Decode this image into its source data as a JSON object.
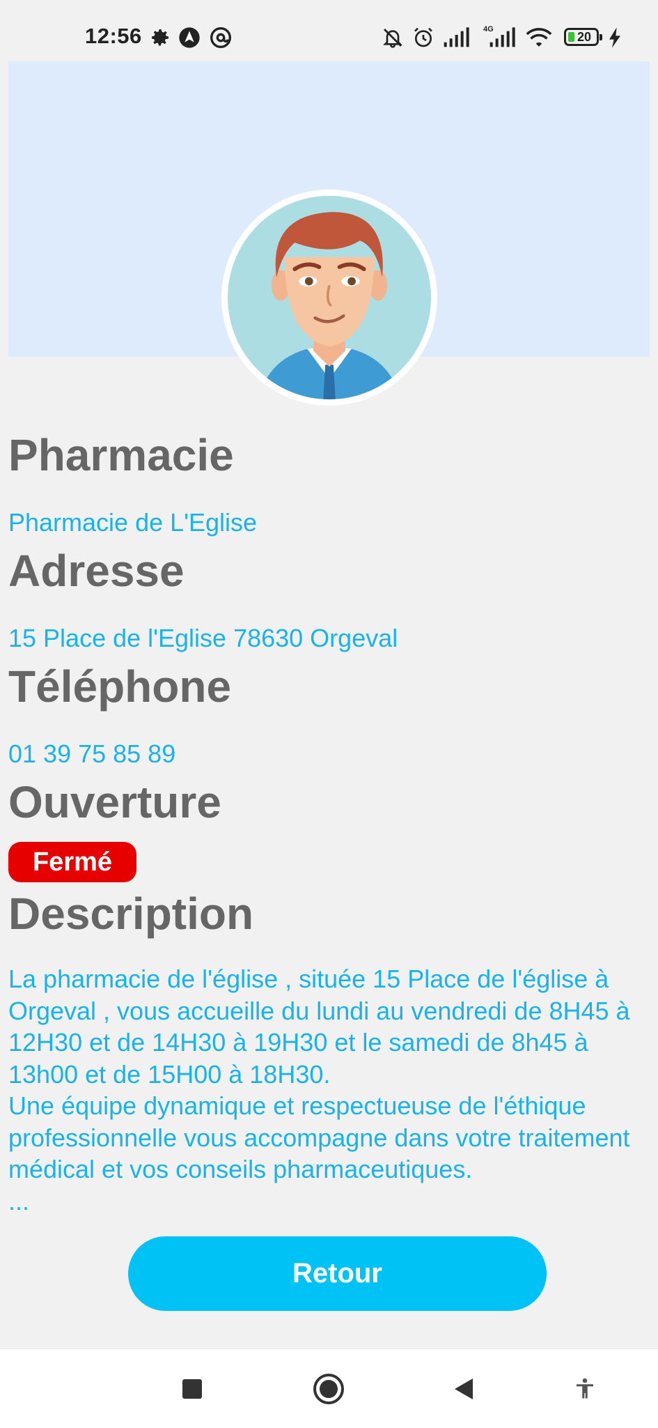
{
  "status_bar": {
    "time": "12:56",
    "network_label": "4G",
    "battery_level": "20",
    "icons": [
      "gear-icon",
      "navigation-icon",
      "at-icon",
      "bell-muted-icon",
      "alarm-icon",
      "signal-icon",
      "signal-4g-icon",
      "wifi-icon",
      "battery-icon",
      "charging-icon"
    ]
  },
  "sections": {
    "pharmacie": {
      "label": "Pharmacie",
      "value": "Pharmacie de L'Eglise"
    },
    "adresse": {
      "label": "Adresse",
      "value": "15 Place de l'Eglise 78630 Orgeval"
    },
    "telephone": {
      "label": "Téléphone",
      "value": "01 39 75 85 89"
    },
    "ouverture": {
      "label": "Ouverture",
      "status": "Fermé",
      "status_color": "#e60000"
    },
    "description": {
      "label": "Description",
      "text": "La pharmacie de l'église , située 15 Place de l'église à Orgeval , vous accueille du lundi au vendredi de 8H45 à 12H30 et de 14H30 à 19H30 et le samedi de 8h45 à 13h00 et de 15H00 à 18H30.\nUne équipe dynamique et respectueuse de l'éthique professionnelle  vous accompagne dans votre traitement médical et vos conseils pharmaceutiques.\n..."
    }
  },
  "actions": {
    "back_label": "Retour"
  },
  "colors": {
    "accent": "#00c2f5",
    "value_text": "#1ab3e8",
    "label_text": "#666666",
    "banner": "#deebfd",
    "closed": "#e60000"
  },
  "nav_bar": {
    "icons": [
      "recents-square-icon",
      "home-circle-icon",
      "back-triangle-icon",
      "accessibility-icon"
    ]
  }
}
